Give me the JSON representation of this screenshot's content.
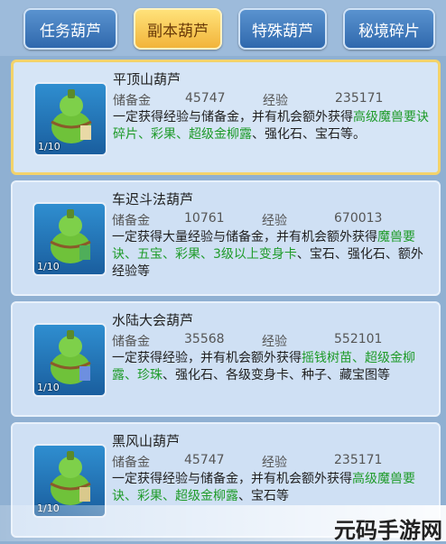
{
  "tabs": [
    {
      "label": "任务葫芦",
      "active": false
    },
    {
      "label": "副本葫芦",
      "active": true
    },
    {
      "label": "特殊葫芦",
      "active": false
    },
    {
      "label": "秘境碎片",
      "active": false
    }
  ],
  "labels": {
    "reserve": "储备金",
    "exp": "经验"
  },
  "items": [
    {
      "name": "平顶山葫芦",
      "reserve": "45747",
      "exp": "235171",
      "count": "1/10",
      "desc": [
        {
          "t": "一定获得经验与储备金，并有机会额外获得",
          "g": false
        },
        {
          "t": "高级魔兽要诀碎片、彩果、超级金柳露",
          "g": true
        },
        {
          "t": "、强化石、宝石等。",
          "g": false
        }
      ]
    },
    {
      "name": "车迟斗法葫芦",
      "reserve": "10761",
      "exp": "670013",
      "count": "1/10",
      "desc": [
        {
          "t": "一定获得大量经验与储备金，并有机会额外获得",
          "g": false
        },
        {
          "t": "魔兽要诀、五宝、彩果、3级以上变身卡",
          "g": true
        },
        {
          "t": "、宝石、强化石、额外经验等",
          "g": false
        }
      ]
    },
    {
      "name": "水陆大会葫芦",
      "reserve": "35568",
      "exp": "552101",
      "count": "1/10",
      "desc": [
        {
          "t": "一定获得经验，并有机会额外获得",
          "g": false
        },
        {
          "t": "摇钱树苗、超级金柳露、珍珠",
          "g": true
        },
        {
          "t": "、强化石、各级变身卡、种子、藏宝图等",
          "g": false
        }
      ]
    },
    {
      "name": "黑风山葫芦",
      "reserve": "45747",
      "exp": "235171",
      "count": "1/10",
      "desc": [
        {
          "t": "一定获得经验与储备金，并有机会额外获得",
          "g": false
        },
        {
          "t": "高级魔兽要诀、彩果、超级金柳露",
          "g": true
        },
        {
          "t": "、宝石等",
          "g": false
        }
      ]
    }
  ],
  "watermark": "元码手游网"
}
